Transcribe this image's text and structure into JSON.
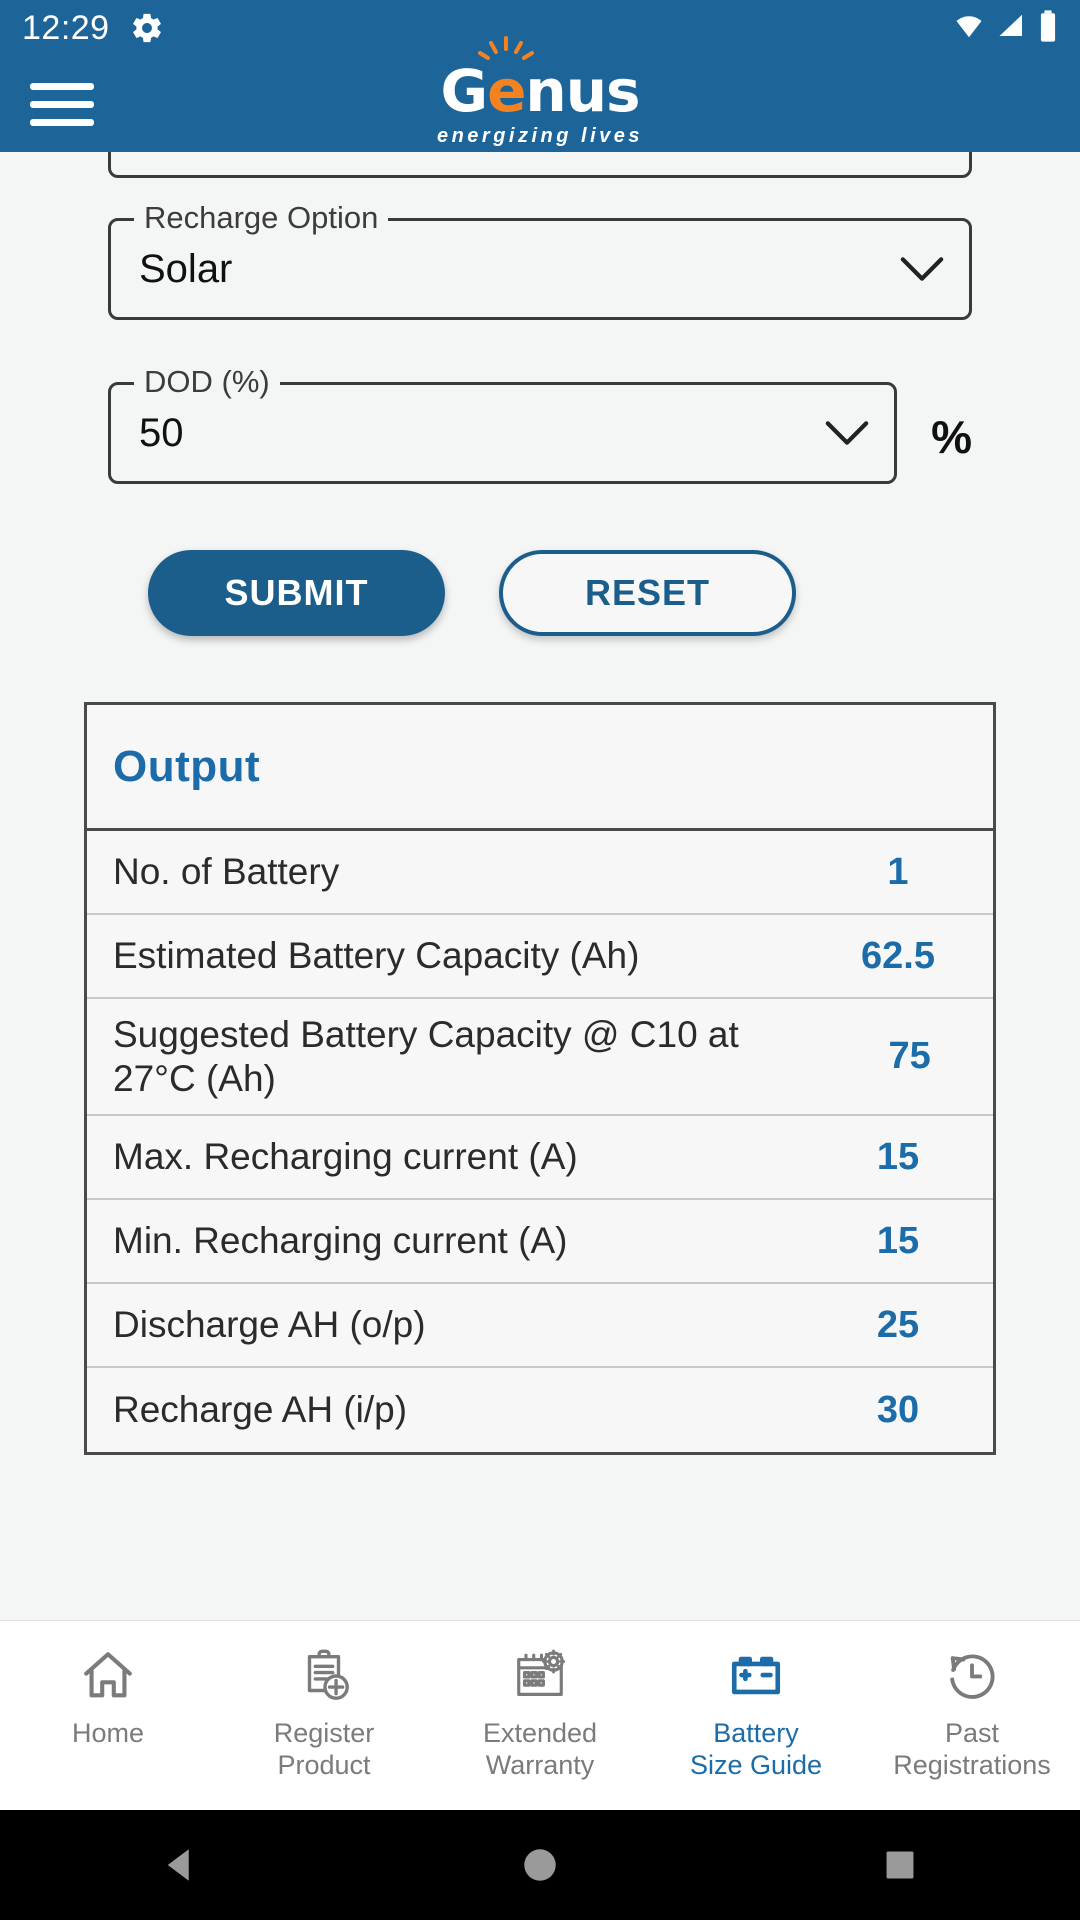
{
  "status_bar": {
    "time": "12:29",
    "icons": [
      "gear-icon",
      "wifi-icon",
      "signal-icon",
      "battery-icon"
    ]
  },
  "app_bar": {
    "menu_icon": "hamburger-menu-icon",
    "logo_part1": "G",
    "logo_part2": "e",
    "logo_part3": "nus",
    "tagline": "energizing lives",
    "brand_blue": "#1d6499",
    "brand_orange": "#f58220"
  },
  "form": {
    "recharge_option": {
      "label": "Recharge Option",
      "value": "Solar",
      "icon": "chevron-down-icon"
    },
    "dod": {
      "label": "DOD (%)",
      "value": "50",
      "icon": "chevron-down-icon",
      "suffix": "%"
    },
    "submit_label": "SUBMIT",
    "reset_label": "RESET"
  },
  "output": {
    "title": "Output",
    "rows": [
      {
        "label": "No. of Battery",
        "value": "1"
      },
      {
        "label": "Estimated Battery Capacity (Ah)",
        "value": "62.5"
      },
      {
        "label": "Suggested Battery Capacity @ C10 at 27°C (Ah)",
        "value": "75"
      },
      {
        "label": "Max. Recharging current (A)",
        "value": "15"
      },
      {
        "label": "Min. Recharging current (A)",
        "value": "15"
      },
      {
        "label": "Discharge AH (o/p)",
        "value": "25"
      },
      {
        "label": "Recharge AH (i/p)",
        "value": "30"
      }
    ]
  },
  "bottom_nav": {
    "active_index": 3,
    "active_color": "#1b6ca8",
    "inactive_color": "#7b7b7b",
    "items": [
      {
        "label": "Home",
        "icon": "home-icon"
      },
      {
        "label": "Register\nProduct",
        "line1": "Register",
        "line2": "Product",
        "icon": "clipboard-plus-icon"
      },
      {
        "label": "Extended\nWarranty",
        "line1": "Extended",
        "line2": "Warranty",
        "icon": "calendar-gear-icon"
      },
      {
        "label": "Battery\nSize Guide",
        "line1": "Battery",
        "line2": "Size Guide",
        "icon": "car-battery-icon"
      },
      {
        "label": "Past\nRegistrations",
        "line1": "Past",
        "line2": "Registrations",
        "icon": "history-clock-icon"
      }
    ]
  },
  "system_nav": {
    "back": "back-triangle-icon",
    "home": "home-circle-icon",
    "recents": "recents-square-icon"
  }
}
